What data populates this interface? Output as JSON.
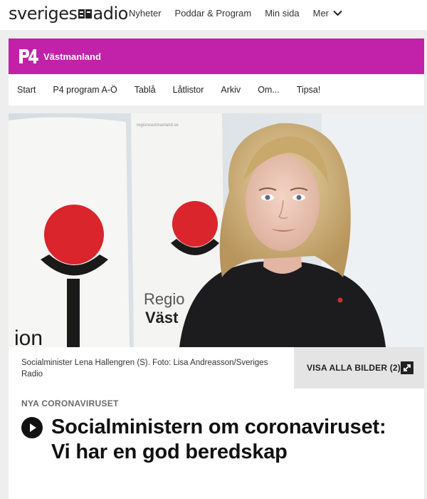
{
  "brand": {
    "logo_left": "sveriges",
    "logo_right": "adio"
  },
  "topnav": {
    "items": [
      "Nyheter",
      "Poddar & Program",
      "Min sida"
    ],
    "more_label": "Mer"
  },
  "channel": {
    "logo_text": "P4",
    "name": "Västmanland",
    "color": "#c221a9"
  },
  "subnav": {
    "items": [
      "Start",
      "P4 program A-Ö",
      "Tablå",
      "Låtlistor",
      "Arkiv",
      "Om...",
      "Tipsa!"
    ]
  },
  "hero": {
    "banner_text_1": "Regio",
    "banner_text_2": "Väst",
    "banner_small": "regionvastmanland.se"
  },
  "caption": {
    "text": "Socialminister Lena Hallengren (S). Foto: Lisa Andreasson/Sveriges Radio",
    "gallery_label": "VISA ALLA BILDER (2)"
  },
  "article": {
    "category": "NYA CORONAVIRUSET",
    "headline": "Socialministern om coronaviruset: Vi har en god beredskap"
  }
}
